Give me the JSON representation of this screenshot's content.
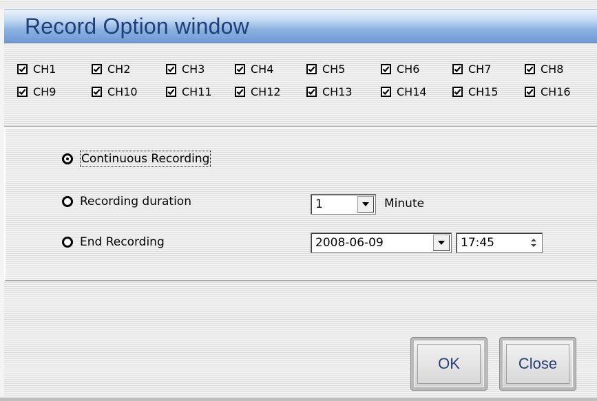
{
  "window": {
    "title": "Record Option window"
  },
  "channels": [
    {
      "label": "CH1",
      "checked": true
    },
    {
      "label": "CH2",
      "checked": true
    },
    {
      "label": "CH3",
      "checked": true
    },
    {
      "label": "CH4",
      "checked": true
    },
    {
      "label": "CH5",
      "checked": true
    },
    {
      "label": "CH6",
      "checked": true
    },
    {
      "label": "CH7",
      "checked": true
    },
    {
      "label": "CH8",
      "checked": true
    },
    {
      "label": "CH9",
      "checked": true
    },
    {
      "label": "CH10",
      "checked": true
    },
    {
      "label": "CH11",
      "checked": true
    },
    {
      "label": "CH12",
      "checked": true
    },
    {
      "label": "CH13",
      "checked": true
    },
    {
      "label": "CH14",
      "checked": true
    },
    {
      "label": "CH15",
      "checked": true
    },
    {
      "label": "CH16",
      "checked": true
    }
  ],
  "options": {
    "continuous": {
      "label": "Continuous Recording",
      "selected": true
    },
    "duration": {
      "label": "Recording duration",
      "selected": false,
      "value": "1",
      "unit": "Minute"
    },
    "end": {
      "label": "End Recording",
      "selected": false,
      "date": "2008-06-09",
      "time": "17:45"
    }
  },
  "buttons": {
    "ok": "OK",
    "close": "Close"
  },
  "colors": {
    "title_text": "#1e3f7a",
    "titlebar": "#8db2e0",
    "button_text": "#2a3f77"
  },
  "icons": {
    "checkbox": "checkmark-icon",
    "dropdown": "triangle-down-icon",
    "spinner": "up-down-arrows-icon"
  }
}
